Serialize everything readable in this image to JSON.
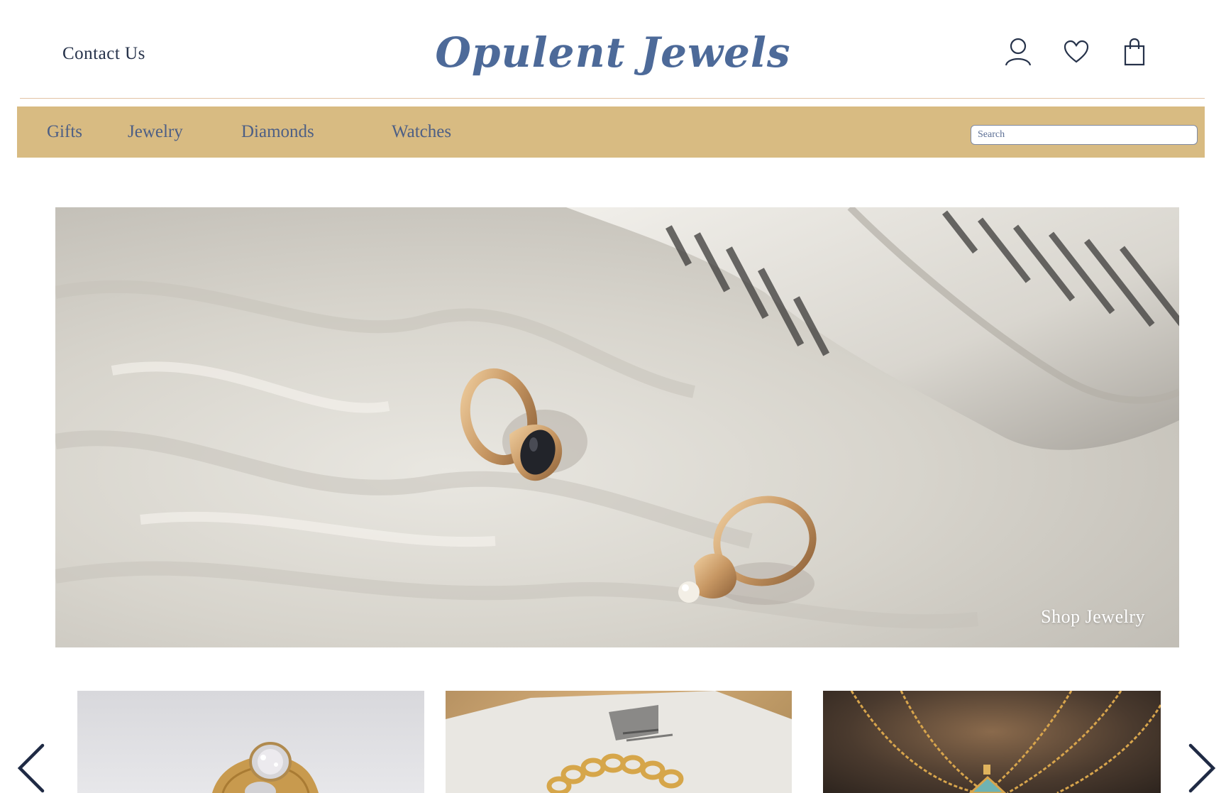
{
  "header": {
    "contact_label": "Contact Us",
    "brand_name": "Opulent Jewels",
    "icons": [
      "user-icon",
      "heart-icon",
      "shopping-bag-icon"
    ]
  },
  "nav": {
    "items": [
      {
        "label": "Gifts"
      },
      {
        "label": "Jewelry"
      },
      {
        "label": "Diamonds"
      },
      {
        "label": "Watches"
      }
    ],
    "search_placeholder": "Search"
  },
  "hero": {
    "cta_label": "Shop Jewelry"
  },
  "carousel": {
    "prev_icon": "chevron-left-icon",
    "next_icon": "chevron-right-icon"
  },
  "colors": {
    "brand_blue": "#4d6a99",
    "nav_gold": "#d8bb82",
    "divider": "#e2c2a4",
    "dark_navy": "#1f2a44"
  }
}
